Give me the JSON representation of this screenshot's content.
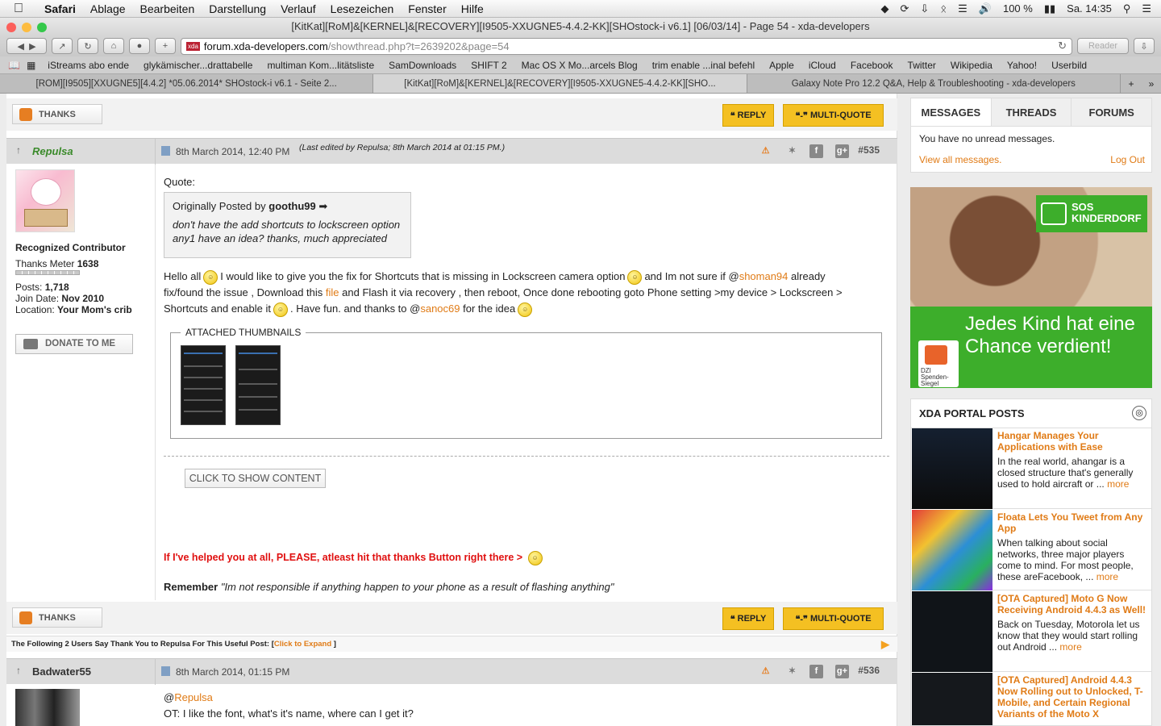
{
  "menubar": {
    "app": "Safari",
    "items": [
      "Ablage",
      "Bearbeiten",
      "Darstellung",
      "Verlauf",
      "Lesezeichen",
      "Fenster",
      "Hilfe"
    ],
    "battery": "100 %",
    "clock": "Sa. 14:35"
  },
  "window": {
    "title": "[KitKat][RoM]&[KERNEL]&[RECOVERY][I9505-XXUGNE5-4.4.2-KK][SHOstock-i v6.1] [06/03/14] - Page 54 - xda-developers"
  },
  "toolbar": {
    "url_host": "forum.xda-developers.com",
    "url_path": "/showthread.php?t=2639202&page=54",
    "reader": "Reader",
    "favicon": "xda"
  },
  "favorites": [
    "iStreams abo ende",
    "glykämischer...drattabelle",
    "multiman Kom...litätsliste",
    "SamDownloads",
    "SHIFT 2",
    "Mac OS X Mo...arcels Blog",
    "trim enable ...inal befehl",
    "Apple",
    "iCloud",
    "Facebook",
    "Twitter",
    "Wikipedia",
    "Yahoo!",
    "Userbild"
  ],
  "tabs": [
    "[ROM][I9505][XXUGNE5][4.4.2] *05.06.2014* SHOstock-i v6.1 - Seite 2...",
    "[KitKat][RoM]&[KERNEL]&[RECOVERY][I9505-XXUGNE5-4.4.2-KK][SHO...",
    "Galaxy Note Pro 12.2 Q&A, Help & Troubleshooting - xda-developers"
  ],
  "buttons": {
    "thanks": "THANKS",
    "reply": "REPLY",
    "multiquote": "MULTI-QUOTE",
    "donate": "DONATE TO ME",
    "show_content": "CLICK TO SHOW CONTENT"
  },
  "post535": {
    "user": "Repulsa",
    "date": "8th March 2014, 12:40 PM",
    "edited": "(Last edited by Repulsa; 8th March 2014 at 01:15 PM.)",
    "number": "#535",
    "rank": "Recognized Contributor",
    "thanks_meter_label": "Thanks Meter",
    "thanks_meter": "1638",
    "posts_label": "Posts:",
    "posts": "1,718",
    "join_label": "Join Date:",
    "join": "Nov 2010",
    "loc_label": "Location:",
    "location": "Your Mom's crib",
    "quote_label": "Quote:",
    "quote_orig": "Originally Posted by",
    "quote_user": "goothu99",
    "quote_text": "don't have the add shortcuts to lockscreen option any1 have an idea? thanks, much appreciated",
    "body_1": "Hello all",
    "body_2": "I would like to give you the fix for Shortcuts that is missing in Lockscreen camera option",
    "body_3": "and Im not sure if @",
    "mention": "shoman94",
    "body_4": "already fix/found the issue , Download this",
    "file": "file",
    "body_5": "and Flash it via recovery , then reboot, Once done rebooting goto Phone setting >my device > Lockscreen > Shortcuts and enable it",
    "body_6": ". Have fun. and thanks to @",
    "mention2": "sanoc69",
    "body_7": "for the idea",
    "attached": "ATTACHED THUMBNAILS",
    "sig_red": "If I've helped you at all, PLEASE, atleast hit that thanks Button right there >",
    "sig_rem_b": "Remember",
    "sig_rem": "\"Im not responsible if anything happen to your phone as a result of flashing anything\"",
    "thanks_line": "The Following 2 Users Say Thank You to Repulsa For This Useful Post: [",
    "thanks_expand": "Click to Expand",
    "thanks_close": "]"
  },
  "post536": {
    "user": "Badwater55",
    "date": "8th March 2014, 01:15 PM",
    "number": "#536",
    "mention": "Repulsa",
    "text": "OT: I like the font, what's it's name, where can I get it?"
  },
  "sidebar": {
    "tabs": [
      "MESSAGES",
      "THREADS",
      "FORUMS"
    ],
    "no_msgs": "You have no unread messages.",
    "view_all": "View all messages.",
    "logout": "Log Out",
    "ad_brand": "SOS KINDERDORF",
    "ad_text": "Jedes Kind hat eine Chance verdient!",
    "ad_seal": "DZI Spenden-Siegel",
    "portal_title": "XDA PORTAL POSTS",
    "portal": [
      {
        "title": "Hangar Manages Your Applications with Ease",
        "text": "In the real world, ahangar is a closed structure that's generally used to hold aircraft or ...",
        "more": "more"
      },
      {
        "title": "Floata Lets You Tweet from Any App",
        "text": "When talking about social networks, three major players come to mind. For most people, these areFacebook, ...",
        "more": "more"
      },
      {
        "title": "[OTA Captured] Moto G Now Receiving Android 4.4.3 as Well!",
        "text": "Back on Tuesday, Motorola let us know that they would start rolling out Android ...",
        "more": "more"
      },
      {
        "title": "[OTA Captured] Android 4.4.3 Now Rolling out to Unlocked, T-Mobile, and Certain Regional Variants of the Moto X",
        "text": "",
        "more": ""
      }
    ]
  },
  "colors": {
    "accent": "#e07b16",
    "button_yellow": "#f4c022",
    "signature_red": "#e01010",
    "ad_green": "#3dae2b"
  }
}
